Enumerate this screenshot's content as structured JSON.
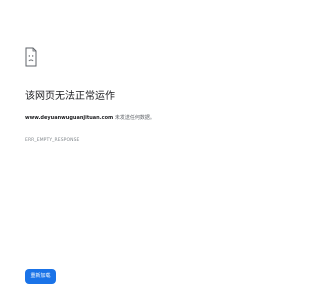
{
  "icon": "sad-page-icon",
  "title": "该网页无法正常运作",
  "message": {
    "domain": "www.deyuanwuguanjituan.com",
    "text": " 未发送任何数据。"
  },
  "error_code": "ERR_EMPTY_RESPONSE",
  "reload_button": "重新加载",
  "colors": {
    "button": "#1a73e8",
    "title": "#202124",
    "message": "#5f6368"
  }
}
